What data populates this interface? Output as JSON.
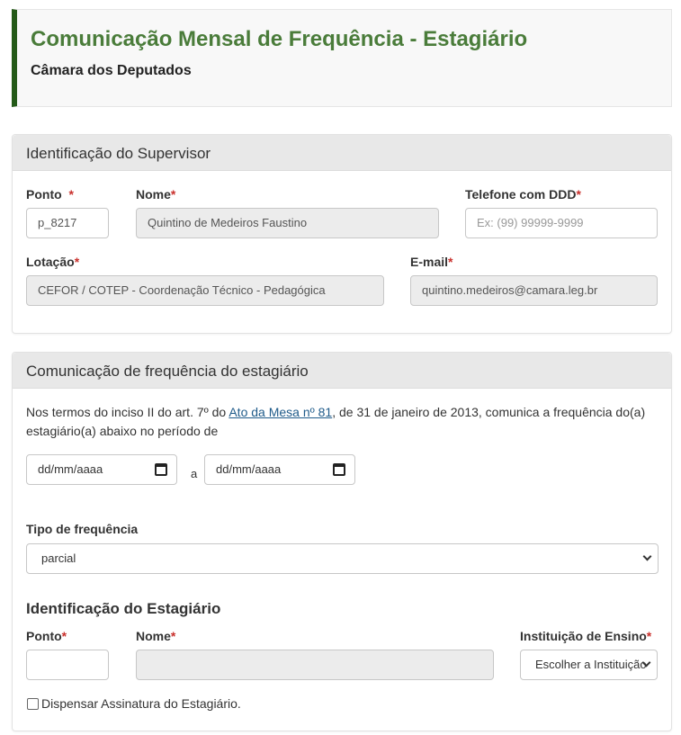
{
  "header": {
    "title": "Comunicação Mensal de Frequência - Estagiário",
    "subtitle": "Câmara dos Deputados"
  },
  "supervisor": {
    "section_title": "Identificação do Supervisor",
    "ponto_label": "Ponto",
    "ponto_value": "p_8217",
    "nome_label": "Nome",
    "nome_value": "Quintino de Medeiros Faustino",
    "telefone_label": "Telefone com DDD",
    "telefone_placeholder": "Ex: (99) 99999-9999",
    "lotacao_label": "Lotação",
    "lotacao_value": "CEFOR / COTEP - Coordenação Técnico - Pedagógica",
    "email_label": "E-mail",
    "email_value": "quintino.medeiros@camara.leg.br",
    "required_mark": "*"
  },
  "frequencia": {
    "section_title": "Comunicação de frequência do estagiário",
    "intro_before_link": "Nos termos do inciso II do art. 7º do ",
    "intro_link": "Ato da Mesa nº 81",
    "intro_after_link": ", de 31 de janeiro de 2013, comunica a frequência do(a)",
    "intro_line2": "estagiário(a) abaixo no período de",
    "date_start_placeholder": "dd/mm/aaaa",
    "date_separator": "a",
    "date_end_placeholder": "dd/mm/aaaa",
    "tipo_label": "Tipo de frequência",
    "tipo_value": "parcial",
    "estagiario_heading": "Identificação do Estagiário",
    "est_ponto_label": "Ponto",
    "est_nome_label": "Nome",
    "instituicao_label": "Instituição de Ensino",
    "instituicao_value": "Escolher a Instituição",
    "dispensar_label": "Dispensar Assinatura do Estagiário."
  },
  "icons": {
    "date": "calendar-icon",
    "select": "chevron-down-icon"
  }
}
